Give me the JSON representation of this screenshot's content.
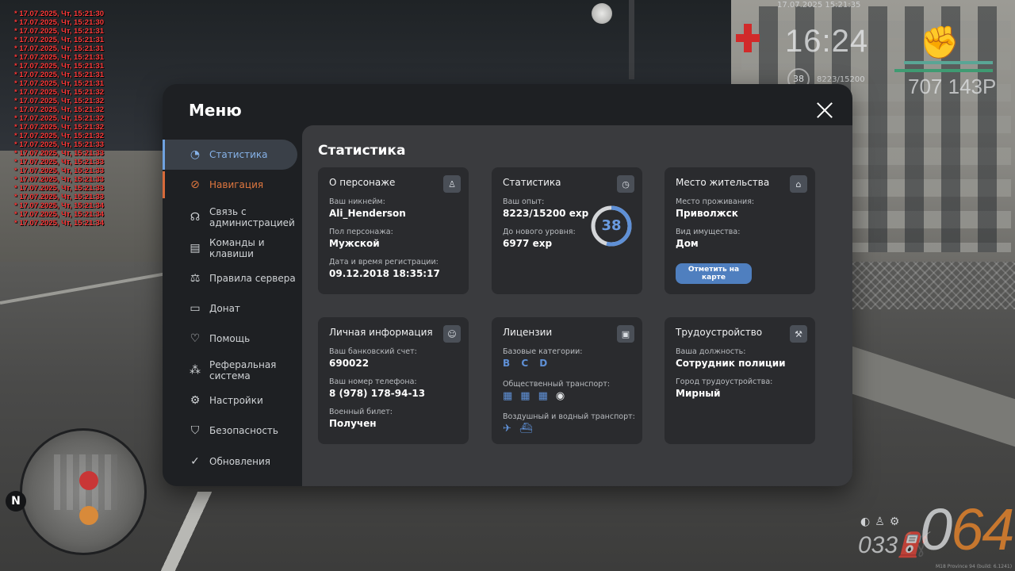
{
  "chat": [
    "* 17.07.2025, Чт, 15:21:30",
    "* 17.07.2025, Чт, 15:21:30",
    "* 17.07.2025, Чт, 15:21:31",
    "* 17.07.2025, Чт, 15:21:31",
    "* 17.07.2025, Чт, 15:21:31",
    "* 17.07.2025, Чт, 15:21:31",
    "* 17.07.2025, Чт, 15:21:31",
    "* 17.07.2025, Чт, 15:21:31",
    "* 17.07.2025, Чт, 15:21:31",
    "* 17.07.2025, Чт, 15:21:32",
    "* 17.07.2025, Чт, 15:21:32",
    "* 17.07.2025, Чт, 15:21:32",
    "* 17.07.2025, Чт, 15:21:32",
    "* 17.07.2025, Чт, 15:21:32",
    "* 17.07.2025, Чт, 15:21:32",
    "* 17.07.2025, Чт, 15:21:33",
    "* 17.07.2025, Чт, 15:21:33",
    "* 17.07.2025, Чт, 15:21:33",
    "* 17.07.2025, Чт, 15:21:33",
    "* 17.07.2025, Чт, 15:21:33",
    "* 17.07.2025, Чт, 15:21:33",
    "* 17.07.2025, Чт, 15:21:33",
    "* 17.07.2025, Чт, 15:21:34",
    "* 17.07.2025, Чт, 15:21:34",
    "* 17.07.2025, Чт, 15:21:34"
  ],
  "hud": {
    "date": "17.07.2025 15:21:35",
    "clock": "16:24",
    "level": "38",
    "exp": "8223/15200",
    "money": "707 143Р",
    "speed_zero": "0",
    "speed_value": "64",
    "fuel": "033",
    "compass": "N",
    "build": "M18 Province 94 (build: 6.1241)"
  },
  "menu": {
    "title": "Меню",
    "nav": [
      {
        "label": "Статистика",
        "icon": "pie-chart-icon"
      },
      {
        "label": "Навигация",
        "icon": "compass-icon"
      },
      {
        "label": "Связь с администрацией",
        "icon": "headset-icon"
      },
      {
        "label": "Команды и клавиши",
        "icon": "document-icon"
      },
      {
        "label": "Правила сервера",
        "icon": "scales-icon"
      },
      {
        "label": "Донат",
        "icon": "wallet-icon"
      },
      {
        "label": "Помощь",
        "icon": "heart-hand-icon"
      },
      {
        "label": "Реферальная система",
        "icon": "network-icon"
      },
      {
        "label": "Настройки",
        "icon": "gear-icon"
      },
      {
        "label": "Безопасность",
        "icon": "shield-icon"
      },
      {
        "label": "Обновления",
        "icon": "refresh-check-icon"
      }
    ]
  },
  "content": {
    "title": "Статистика",
    "character": {
      "title": "О персонаже",
      "nickname_label": "Ваш никнейм:",
      "nickname": "Ali_Henderson",
      "gender_label": "Пол персонажа:",
      "gender": "Мужской",
      "reg_label": "Дата и время регистрации:",
      "reg": "09.12.2018 18:35:17"
    },
    "stats": {
      "title": "Статистика",
      "exp_label": "Ваш опыт:",
      "exp": "8223/15200 exp",
      "next_label": "До нового уровня:",
      "next": "6977 exp",
      "level": "38",
      "level_progress": 0.541
    },
    "residence": {
      "title": "Место жительства",
      "place_label": "Место проживания:",
      "place": "Приволжск",
      "property_label": "Вид имущества:",
      "property": "Дом",
      "button": "Отметить на карте"
    },
    "personal": {
      "title": "Личная информация",
      "bank_label": "Ваш банковский счет:",
      "bank": "690022",
      "phone_label": "Ваш номер телефона:",
      "phone": "8 (978) 178-94-13",
      "military_label": "Военный билет:",
      "military": "Получен"
    },
    "licenses": {
      "title": "Лицензии",
      "base_label": "Базовые категории:",
      "base": "B C D",
      "public_label": "Общественный транспорт:",
      "air_label": "Воздушный и водный транспорт:"
    },
    "job": {
      "title": "Трудоустройство",
      "position_label": "Ваша должность:",
      "position": "Сотрудник полиции",
      "city_label": "Город трудоустройства:",
      "city": "Мирный"
    }
  },
  "colors": {
    "accent_active": "#86b2e8",
    "accent_hover": "#e0773f",
    "button": "#4f7fbf"
  }
}
